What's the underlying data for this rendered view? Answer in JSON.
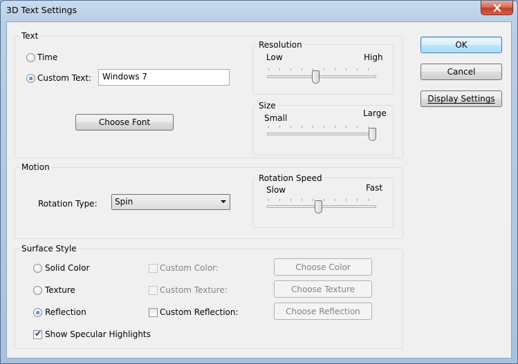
{
  "window": {
    "title": "3D Text Settings"
  },
  "text_group": {
    "label": "Text",
    "time_label": "Time",
    "custom_text_label": "Custom Text:",
    "custom_text_value": "Windows 7",
    "choose_font": "Choose Font"
  },
  "resolution": {
    "label": "Resolution",
    "low": "Low",
    "high": "High",
    "level": 0.5
  },
  "size": {
    "label": "Size",
    "small": "Small",
    "large": "Large",
    "level": 1.0
  },
  "motion_group": {
    "label": "Motion",
    "rotation_type_label": "Rotation Type:",
    "rotation_type_value": "Spin"
  },
  "rotation_speed": {
    "label": "Rotation Speed",
    "slow": "Slow",
    "fast": "Fast",
    "level": 0.5
  },
  "surface_group": {
    "label": "Surface Style",
    "solid_color": "Solid Color",
    "texture": "Texture",
    "reflection": "Reflection",
    "custom_color": "Custom Color:",
    "custom_texture": "Custom Texture:",
    "custom_reflection": "Custom Reflection:",
    "choose_color": "Choose Color",
    "choose_texture": "Choose Texture",
    "choose_reflection": "Choose Reflection",
    "show_specular": "Show Specular Highlights"
  },
  "buttons": {
    "ok": "OK",
    "cancel": "Cancel",
    "display_settings": "Display Settings"
  },
  "colors": {
    "accent": "#3c7fb1",
    "close": "#c1412a"
  }
}
